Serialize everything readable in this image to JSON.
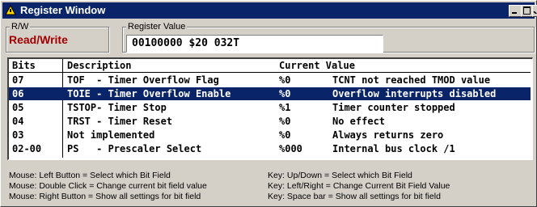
{
  "window": {
    "title": "Register Window",
    "colors": {
      "titlebar": "#0a246a",
      "rw_value": "#a00000",
      "selection": "#0a246a"
    }
  },
  "rw": {
    "label": "R/W",
    "value": "Read/Write"
  },
  "register": {
    "label": "Register Value",
    "value": "00100000 $20  032T"
  },
  "table": {
    "headers": [
      "Bits",
      "Description",
      "Current Value"
    ],
    "selected_index": 1,
    "rows": [
      {
        "bits": "07",
        "desc": "TOF  - Timer Overflow Flag",
        "value": "%0",
        "meaning": "TCNT not reached TMOD value"
      },
      {
        "bits": "06",
        "desc": "TOIE - Timer Overflow Enable",
        "value": "%0",
        "meaning": "Overflow interrupts disabled"
      },
      {
        "bits": "05",
        "desc": "TSTOP- Timer Stop",
        "value": "%1",
        "meaning": "Timer counter stopped"
      },
      {
        "bits": "04",
        "desc": "TRST - Timer Reset",
        "value": "%0",
        "meaning": "No effect"
      },
      {
        "bits": "03",
        "desc": "Not implemented",
        "value": "%0",
        "meaning": "Always returns zero"
      },
      {
        "bits": "02-00",
        "desc": "PS   - Prescaler Select",
        "value": "%000",
        "meaning": "Internal bus clock /1"
      }
    ]
  },
  "help": {
    "mouse": [
      "Mouse: Left Button = Select which Bit Field",
      "Mouse: Double Click = Change current bit field value",
      "Mouse: Right Button = Show all settings for bit field"
    ],
    "keys": [
      "Key: Up/Down = Select which Bit Field",
      "Key: Left/Right = Change Current Bit Field Value",
      "Key: Space bar = Show all settings for bit field"
    ]
  }
}
